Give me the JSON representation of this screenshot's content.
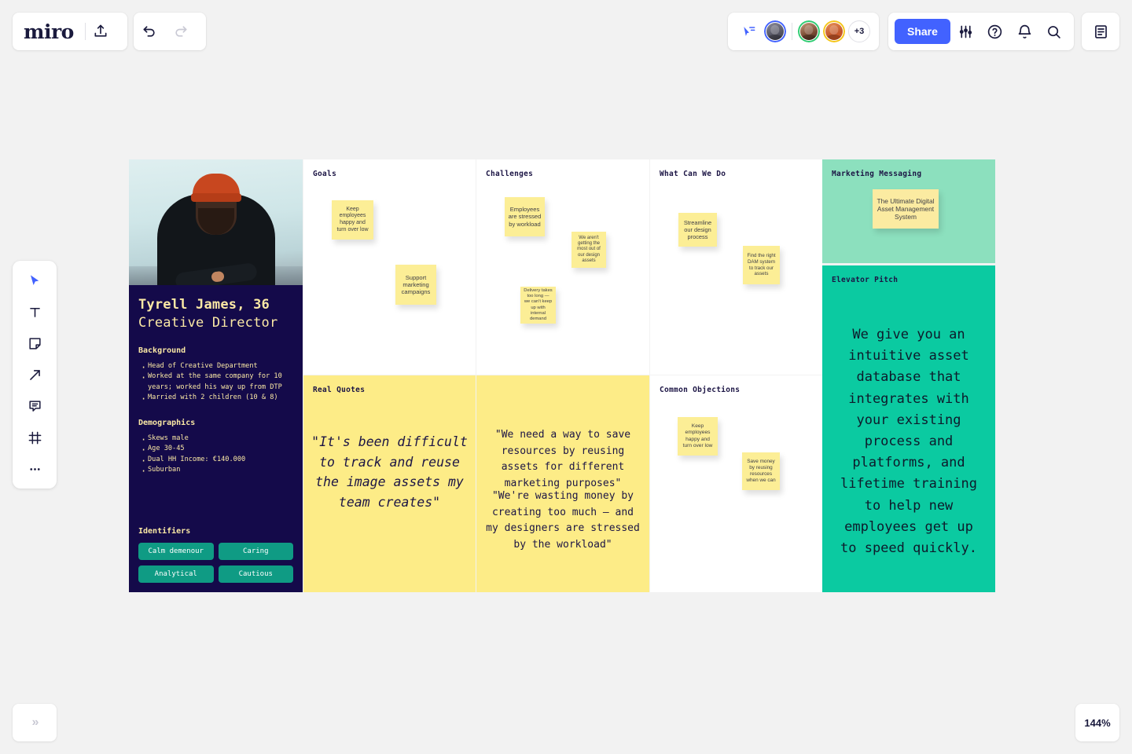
{
  "app": {
    "brand": "miro",
    "zoom_level": "144%",
    "expand_icon": "»"
  },
  "topbar": {
    "upload_icon": "upload-icon",
    "undo_icon": "undo-icon",
    "redo_icon": "redo-icon",
    "cursor_icon": "collaboration-cursor-icon",
    "avatars_overflow": "+3",
    "share_label": "Share",
    "settings_icon": "sliders-icon",
    "help_icon": "help-icon",
    "notifications_icon": "bell-icon",
    "search_icon": "search-icon",
    "notes_icon": "notes-panel-icon"
  },
  "toolbar": {
    "items": [
      {
        "name": "select-tool",
        "icon": "cursor-arrow-icon"
      },
      {
        "name": "text-tool",
        "icon": "text-icon"
      },
      {
        "name": "sticky-note-tool",
        "icon": "sticky-note-icon"
      },
      {
        "name": "arrow-tool",
        "icon": "arrow-icon"
      },
      {
        "name": "comment-tool",
        "icon": "comment-icon"
      },
      {
        "name": "frame-tool",
        "icon": "frame-icon"
      },
      {
        "name": "more-tools",
        "icon": "ellipsis-icon"
      }
    ]
  },
  "persona": {
    "name": "Tyrell James, 36",
    "role": "Creative Director",
    "background_heading": "Background",
    "background": [
      "Head of Creative Department",
      "Worked at the same company for 10 years; worked his way up from DTP",
      "Married with 2 children (10 & 8)"
    ],
    "demographics_heading": "Demographics",
    "demographics": [
      "Skews male",
      "Age 30-45",
      "Dual HH Income: €140.000",
      "Suburban"
    ],
    "identifiers_heading": "Identifiers",
    "identifiers": [
      "Calm demenour",
      "Caring",
      "Analytical",
      "Cautious"
    ]
  },
  "board": {
    "goals": {
      "title": "Goals",
      "notes": [
        "Keep employees happy and turn over low",
        "Support marketing campaigns"
      ]
    },
    "challenges": {
      "title": "Challenges",
      "notes": [
        "Employees are stressed by workload",
        "We aren't getting the most out of our design assets",
        "Delivery takes too long — we can't keep up with internal demand"
      ]
    },
    "what_can_we_do": {
      "title": "What Can We Do",
      "notes": [
        "Streamline our design process",
        "Find the right DAM system to track our assets"
      ]
    },
    "marketing_messaging": {
      "title": "Marketing Messaging",
      "notes": [
        "The Ultimate Digital Asset Management System"
      ]
    },
    "elevator_pitch": {
      "title": "Elevator Pitch",
      "text": "We give you an intuitive asset database that integrates with your existing process and platforms, and lifetime training to help new employees get up to speed quickly."
    },
    "real_quotes": {
      "title": "Real Quotes",
      "quote_primary": "\"It's been difficult to track and reuse the image assets my team creates\"",
      "quote_secondary_1": "\"We need a way to save resources by reusing assets for different marketing purposes\"",
      "quote_secondary_2": "\"We're wasting money by creating too much — and my designers are stressed by the workload\""
    },
    "common_objections": {
      "title": "Common Objections",
      "notes": [
        "Keep employees happy and turn over low",
        "Save money by reusing resources when we can"
      ]
    }
  },
  "colors": {
    "accent_blue": "#4262ff",
    "navy": "#140a4a",
    "cream": "#fbe9a5",
    "sticky_yellow": "#fcee96",
    "panel_yellow": "#fdec87",
    "mint": "#8ce0be",
    "teal": "#0bcaa1",
    "chip_teal": "#0f9b84"
  }
}
